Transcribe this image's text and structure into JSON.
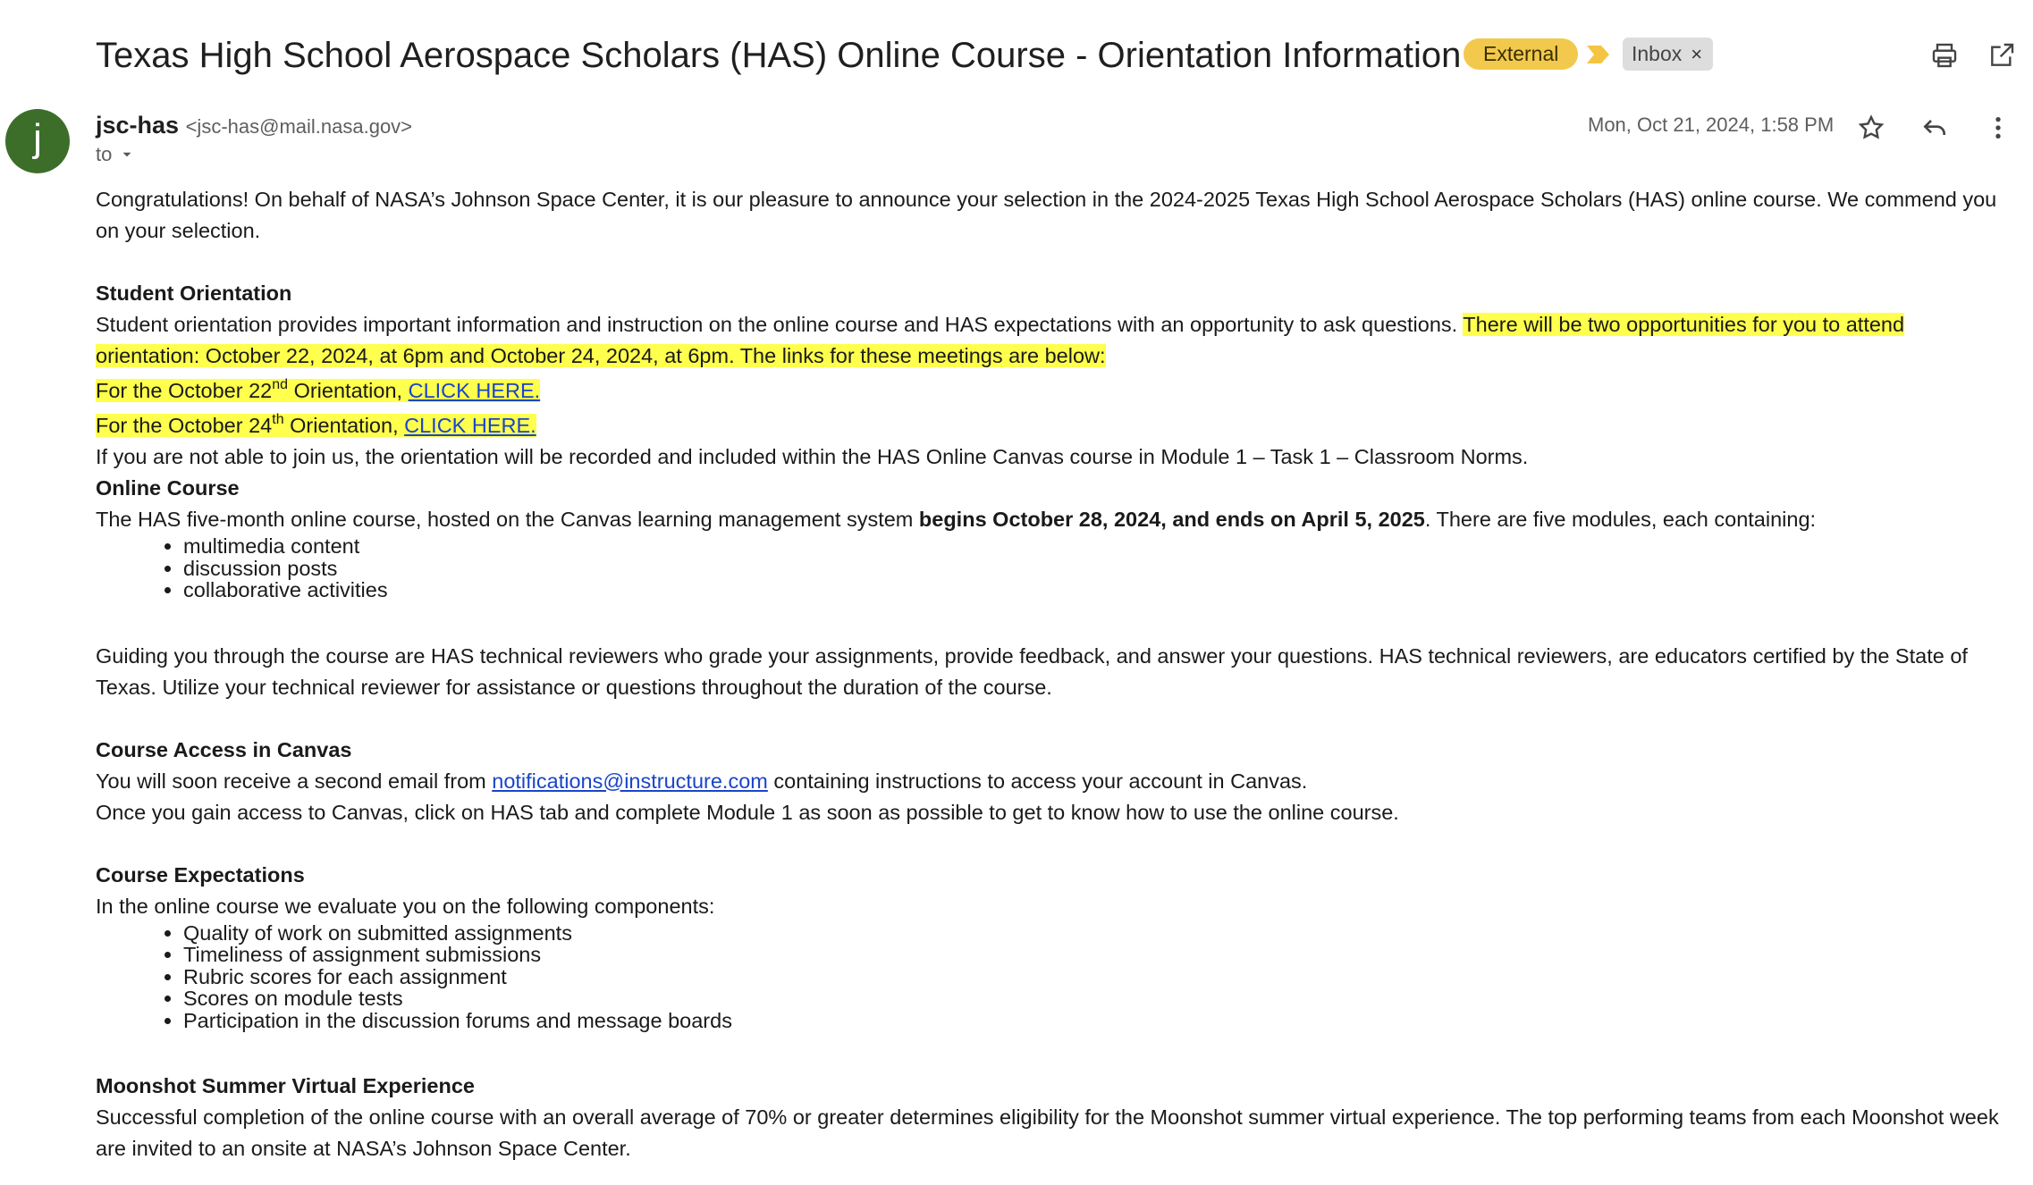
{
  "header": {
    "subject": "Texas High School Aerospace Scholars (HAS) Online Course - Orientation Information",
    "label_external": "External",
    "label_inbox": "Inbox",
    "label_inbox_remove": "×",
    "icons": {
      "print": "print-icon",
      "open_new_window": "open-in-new-window-icon",
      "importance": "importance-marker-icon"
    }
  },
  "message": {
    "avatar_letter": "j",
    "sender_name": "jsc-has",
    "sender_email": "<jsc-has@mail.nasa.gov>",
    "to_label": "to",
    "date": "Mon, Oct 21, 2024, 1:58 PM",
    "icons": {
      "star": "star-icon",
      "reply": "reply-icon",
      "more": "more-vert-icon"
    }
  },
  "body": {
    "intro": "Congratulations! On behalf of NASA’s Johnson Space Center, it is our pleasure to announce your selection in the 2024-2025 Texas High School Aerospace Scholars (HAS) online course. We commend you on your selection.",
    "orientation_heading": "Student Orientation",
    "orientation_text": "Student orientation provides important information and instruction on the online course and HAS expectations with an opportunity to ask questions.  ",
    "orientation_highlight": "There will be two opportunities for you to attend orientation: October 22, 2024, at 6pm and October 24, 2024, at 6pm. The links for these meetings are below:",
    "link22_prefix": "For the October 22",
    "link22_sup": "nd",
    "link22_suffix": " Orientation, ",
    "link24_prefix": "For the October 24",
    "link24_sup": "th",
    "link24_suffix": " Orientation, ",
    "click_here": "CLICK HERE.",
    "recorded_note": "If you are not able to join us, the orientation will be recorded and included within the HAS Online Canvas course in Module 1 – Task 1 – Classroom Norms.",
    "online_heading": "Online Course",
    "online_text_1": "The HAS five-month online course, hosted on the Canvas learning management system ",
    "online_text_bold": "begins October 28, 2024, and ends on April 5, 2025",
    "online_text_2": ". There are five modules, each containing:",
    "module_items": [
      "multimedia content",
      "discussion posts",
      "collaborative activities"
    ],
    "reviewers_text": "Guiding you through the course are HAS technical reviewers who grade your assignments, provide feedback, and answer your questions. HAS technical reviewers, are educators certified by the State of Texas. Utilize your technical reviewer for assistance or questions throughout the duration of the course.",
    "access_heading": "Course Access in Canvas",
    "access_text_1": "You will soon receive a second email from ",
    "access_email": "notifications@instructure.com",
    "access_text_2": " containing instructions to access your account in Canvas.",
    "access_text_3": "Once you gain access to Canvas, click on HAS tab and complete Module 1 as soon as possible to get to know how to use the online course.",
    "expect_heading": "Course Expectations",
    "expect_text": "In the online course we evaluate you on the following components:",
    "expect_items": [
      "Quality of work on submitted assignments",
      "Timeliness of assignment submissions",
      "Rubric scores for each assignment",
      "Scores on module tests",
      "Participation in the discussion forums and message boards"
    ],
    "moonshot_heading": "Moonshot Summer Virtual Experience",
    "moonshot_text": "Successful completion of the online course with an overall average of 70% or greater determines eligibility for the Moonshot summer virtual experience. The top performing teams from each Moonshot week are invited to an onsite at NASA’s Johnson Space Center."
  },
  "colors": {
    "highlight": "#ffff4d",
    "link": "#1a45c9",
    "external_label": "#f2c94c",
    "avatar": "#3c6e2a"
  }
}
